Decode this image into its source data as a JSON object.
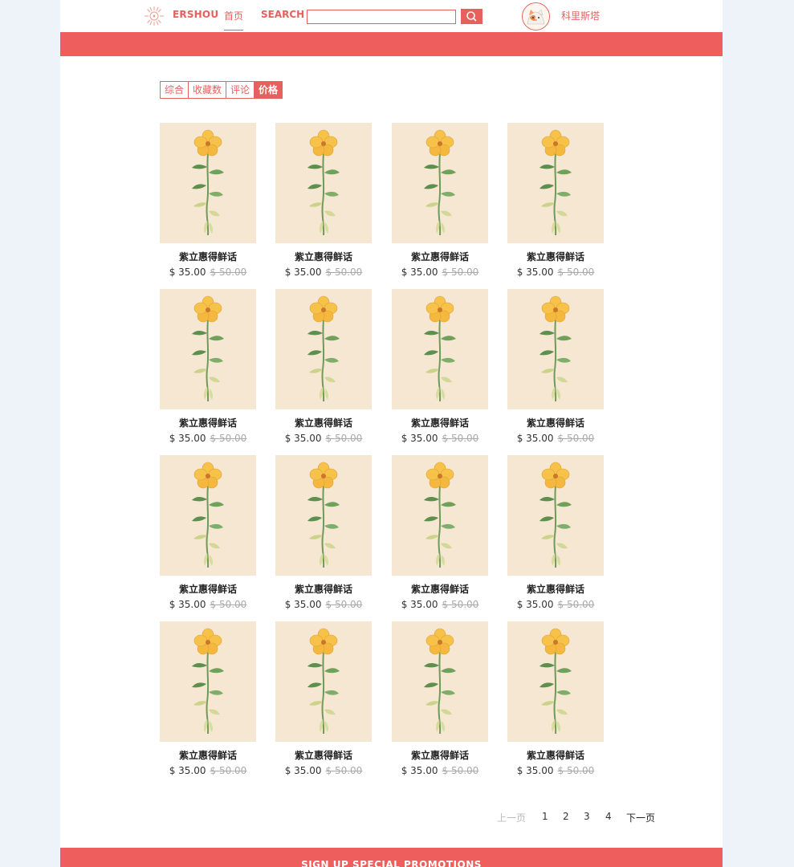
{
  "header": {
    "logo_text": "ERSHOU",
    "nav_home": "首页",
    "search_label": "SEARCH",
    "search_value": "",
    "username": "科里斯塔",
    "colors": {
      "accent": "#e8605e",
      "banner": "#ee5e5c"
    }
  },
  "sort_tabs": [
    {
      "label": "综合",
      "active": false
    },
    {
      "label": "收藏数",
      "active": false
    },
    {
      "label": "评论",
      "active": false
    },
    {
      "label": "价格",
      "active": true
    }
  ],
  "products": [
    {
      "name": "紫立惠得鲜话",
      "price": "$ 35.00",
      "old_price": "$ 50.00"
    },
    {
      "name": "紫立惠得鲜话",
      "price": "$ 35.00",
      "old_price": "$ 50.00"
    },
    {
      "name": "紫立惠得鲜话",
      "price": "$ 35.00",
      "old_price": "$ 50.00"
    },
    {
      "name": "紫立惠得鲜话",
      "price": "$ 35.00",
      "old_price": "$ 50.00"
    },
    {
      "name": "紫立惠得鲜话",
      "price": "$ 35.00",
      "old_price": "$ 50.00"
    },
    {
      "name": "紫立惠得鲜话",
      "price": "$ 35.00",
      "old_price": "$ 50.00"
    },
    {
      "name": "紫立惠得鲜话",
      "price": "$ 35.00",
      "old_price": "$ 50.00"
    },
    {
      "name": "紫立惠得鲜话",
      "price": "$ 35.00",
      "old_price": "$ 50.00"
    },
    {
      "name": "紫立惠得鲜话",
      "price": "$ 35.00",
      "old_price": "$ 50.00"
    },
    {
      "name": "紫立惠得鲜话",
      "price": "$ 35.00",
      "old_price": "$ 50.00"
    },
    {
      "name": "紫立惠得鲜话",
      "price": "$ 35.00",
      "old_price": "$ 50.00"
    },
    {
      "name": "紫立惠得鲜话",
      "price": "$ 35.00",
      "old_price": "$ 50.00"
    },
    {
      "name": "紫立惠得鲜话",
      "price": "$ 35.00",
      "old_price": "$ 50.00"
    },
    {
      "name": "紫立惠得鲜话",
      "price": "$ 35.00",
      "old_price": "$ 50.00"
    },
    {
      "name": "紫立惠得鲜话",
      "price": "$ 35.00",
      "old_price": "$ 50.00"
    },
    {
      "name": "紫立惠得鲜话",
      "price": "$ 35.00",
      "old_price": "$ 50.00"
    }
  ],
  "pagination": {
    "prev": "上一页",
    "pages": [
      "1",
      "2",
      "3",
      "4"
    ],
    "next": "下一页"
  },
  "footer": {
    "promo_text": "SIGN UP SPECIAL PROMOTIONS"
  }
}
